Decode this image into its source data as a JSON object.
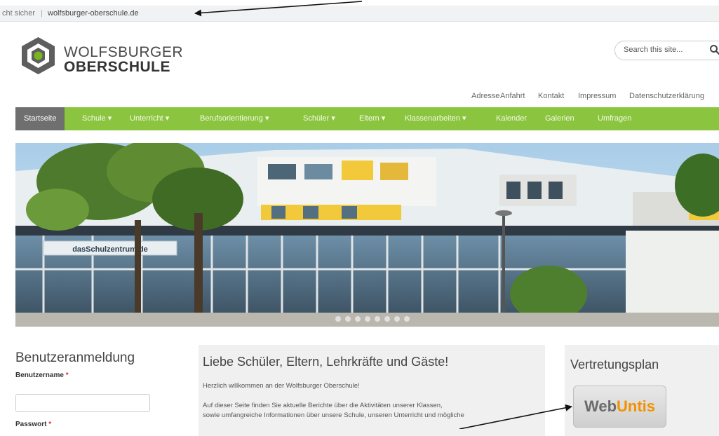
{
  "address_bar": {
    "security_text": "cht sicher",
    "separator": "|",
    "url": "wolfsburger-oberschule.de"
  },
  "header": {
    "logo_line1": "WOLFSBURGER",
    "logo_line2": "OBERSCHULE",
    "search_placeholder": "Search this site...",
    "top_links": [
      "Adresse",
      "Anfahrt",
      "Kontakt",
      "Impressum",
      "Datenschutzerklärung"
    ]
  },
  "nav": {
    "items": [
      {
        "label": "Startseite"
      },
      {
        "label": "Schule ▾"
      },
      {
        "label": "Unterricht ▾"
      },
      {
        "label": "Berufsorientierung ▾"
      },
      {
        "label": "Schüler ▾"
      },
      {
        "label": "Eltern ▾"
      },
      {
        "label": "Klassenarbeiten ▾"
      },
      {
        "label": "Kalender"
      },
      {
        "label": "Galerien"
      },
      {
        "label": "Umfragen"
      }
    ],
    "active_index": 0
  },
  "hero": {
    "building_sign": "dasSchulzentrum.de",
    "slide_count": 8
  },
  "login": {
    "title": "Benutzeranmeldung",
    "username_label": "Benutzername",
    "password_label": "Passwort",
    "required_mark": "*"
  },
  "welcome": {
    "title": "Liebe Schüler, Eltern, Lehrkräfte und Gäste!",
    "greeting": "Herzlich willkommen an der Wolfsburger Oberschule!",
    "text_line1": "Auf dieser Seite finden Sie aktuelle Berichte über die Aktivitäten unserer Klassen,",
    "text_line2": "sowie umfangreiche Informationen über unsere Schule, unseren Unterricht und mögliche"
  },
  "sidebar": {
    "vplan_title": "Vertretungsplan",
    "webuntis_part1": "Web",
    "webuntis_part2": "Untis"
  },
  "colors": {
    "nav_green": "#8bc53f",
    "nav_active": "#6f6f6f",
    "logo_green": "#7ab51d",
    "webuntis_orange": "#f39200"
  }
}
